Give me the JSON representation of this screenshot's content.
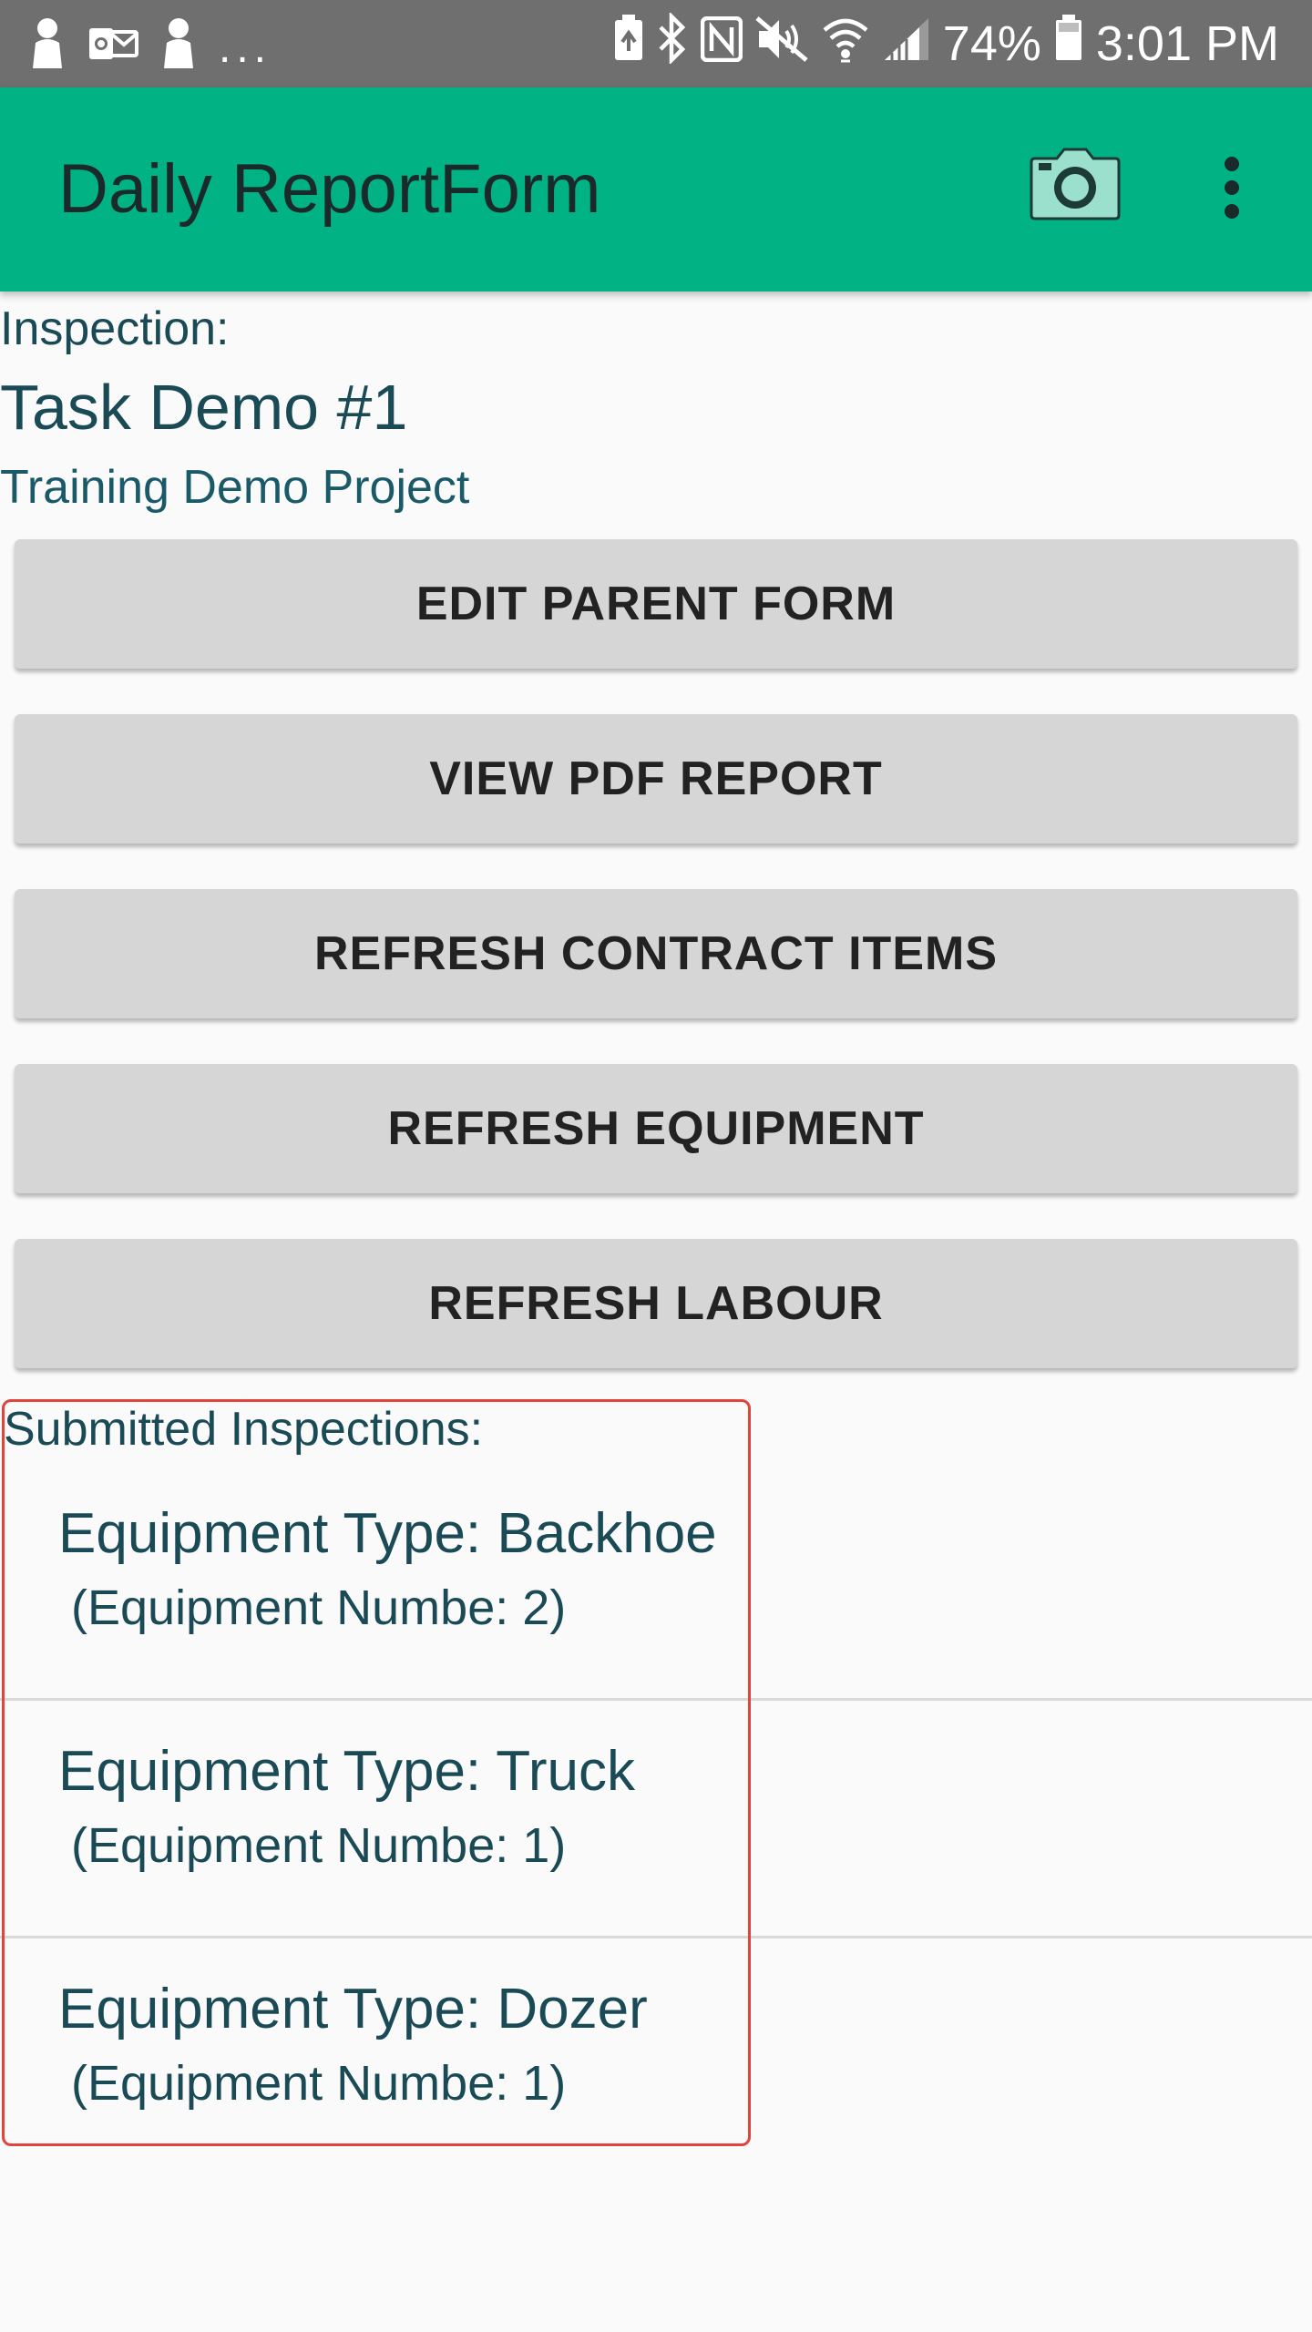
{
  "status_bar": {
    "notification_icons": [
      "person-icon",
      "outlook-icon",
      "person-icon"
    ],
    "ellipsis": "...",
    "battery_percent": "74%",
    "time": "3:01 PM"
  },
  "app_bar": {
    "title": "Daily ReportForm",
    "camera_icon": "camera-icon",
    "menu_icon": "more-vert-icon",
    "accent_color": "#00b284"
  },
  "header": {
    "inspection_label": "Inspection:",
    "task_name": "Task Demo #1",
    "project_name": "Training Demo Project"
  },
  "buttons": [
    {
      "label": "EDIT PARENT FORM"
    },
    {
      "label": "VIEW PDF REPORT"
    },
    {
      "label": "REFRESH CONTRACT ITEMS"
    },
    {
      "label": "REFRESH EQUIPMENT"
    },
    {
      "label": "REFRESH LABOUR"
    }
  ],
  "submitted": {
    "label": "Submitted Inspections:",
    "items": [
      {
        "title": "Equipment Type: Backhoe",
        "subtitle": "(Equipment Numbe: 2)"
      },
      {
        "title": "Equipment Type: Truck",
        "subtitle": "(Equipment Numbe: 1)"
      },
      {
        "title": "Equipment Type: Dozer",
        "subtitle": "(Equipment Numbe: 1)"
      }
    ]
  },
  "highlight_color": "#e0443a"
}
